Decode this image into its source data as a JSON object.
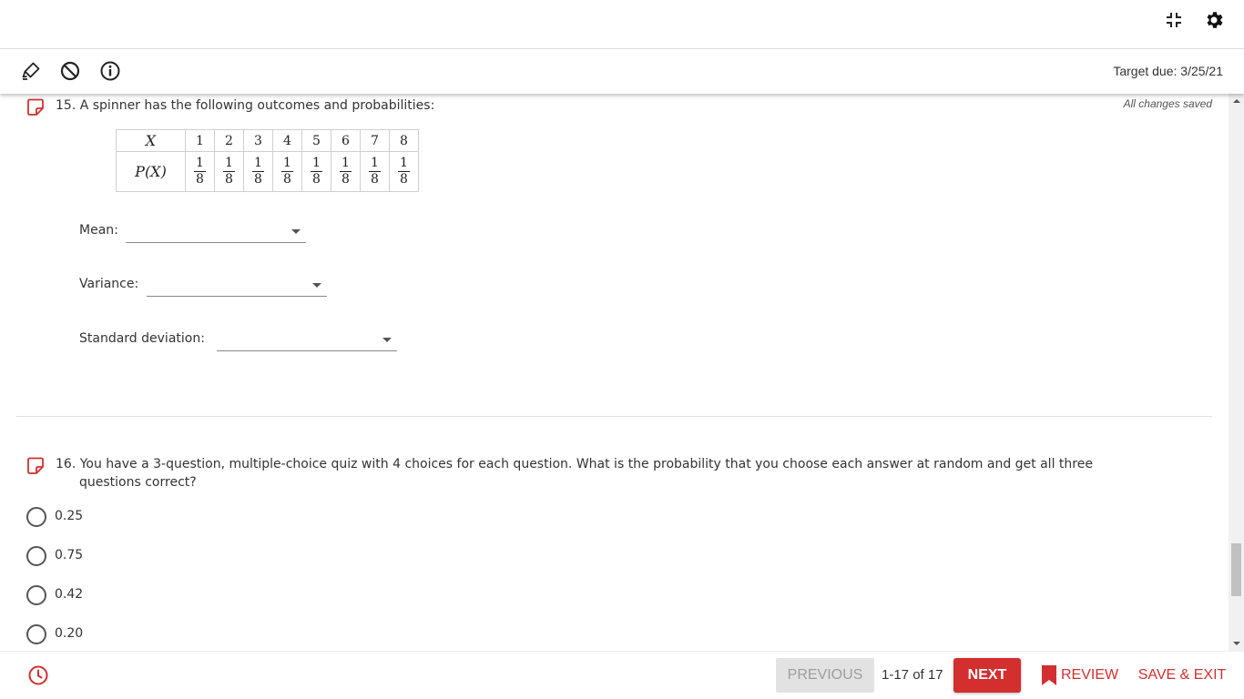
{
  "header": {
    "icons": {
      "collapse": "collapse-icon",
      "settings": "gear-icon"
    }
  },
  "toolbar": {
    "icons": {
      "highlighter": "highlighter-icon",
      "eliminate": "eliminator-icon",
      "info": "info-icon"
    },
    "target_due": "Target due: 3/25/21"
  },
  "status": {
    "saved": "All changes saved"
  },
  "question15": {
    "number": "15.",
    "text": "A spinner has the following outcomes and probabilities:",
    "table": {
      "x_label": "X",
      "px_label": "P(X)",
      "outcomes": [
        "1",
        "2",
        "3",
        "4",
        "5",
        "6",
        "7",
        "8"
      ],
      "prob_numerators": [
        "1",
        "1",
        "1",
        "1",
        "1",
        "1",
        "1",
        "1"
      ],
      "prob_denominators": [
        "8",
        "8",
        "8",
        "8",
        "8",
        "8",
        "8",
        "8"
      ]
    },
    "fields": {
      "mean_label": "Mean:",
      "mean_value": "",
      "variance_label": "Variance:",
      "variance_value": "",
      "sd_label": "Standard deviation:",
      "sd_value": ""
    }
  },
  "question16": {
    "number": "16.",
    "text_line1": "You have a 3-question, multiple-choice quiz with 4 choices for each question. What is the probability that you choose each answer at random and get all three",
    "text_line2": "questions correct?",
    "options": [
      "0.25",
      "0.75",
      "0.42",
      "0.20"
    ]
  },
  "footer": {
    "previous": "PREVIOUS",
    "pager": "1-17 of 17",
    "next": "NEXT",
    "review": "REVIEW",
    "save_exit": "SAVE & EXIT",
    "icons": {
      "timer": "clock-icon",
      "review": "bookmark-icon"
    }
  },
  "colors": {
    "accent": "#d32f2f",
    "disabled": "#e2e2e2",
    "text": "#333333"
  }
}
